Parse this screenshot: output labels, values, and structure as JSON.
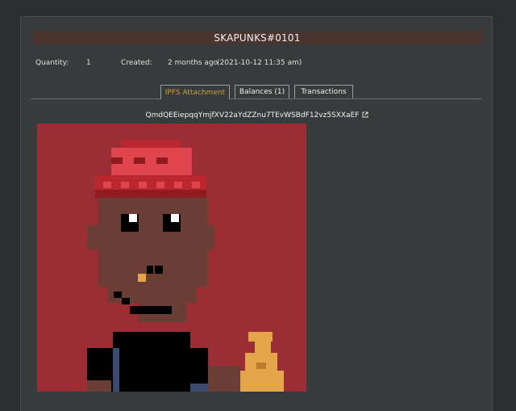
{
  "token": {
    "title": "SKAPUNKS#0101",
    "quantity_label": "Quantity:",
    "quantity_value": "1",
    "created_label": "Created:",
    "created_relative": "2 months ago",
    "created_timestamp": "(2021-10-12 11:35 am)"
  },
  "tabs": [
    {
      "label": "IPFS Attachment",
      "active": true
    },
    {
      "label": "Balances (1)",
      "active": false
    },
    {
      "label": "Transactions",
      "active": false
    }
  ],
  "attachment": {
    "cid": "QmdQEEiepqqYmjfXV22aYdZZnu7TEvWSBdF12vz5SXXaEF",
    "link_icon": "external-link-icon"
  },
  "colors": {
    "accent": "#c9a13d",
    "title_bar": "#4a3430",
    "nft_background": "#9b2d35",
    "hat_red": "#e0444c",
    "hat_dark": "#8f1a1f",
    "skin": "#6a3e34",
    "shirt": "#000000",
    "trophy": "#e3a44a"
  }
}
